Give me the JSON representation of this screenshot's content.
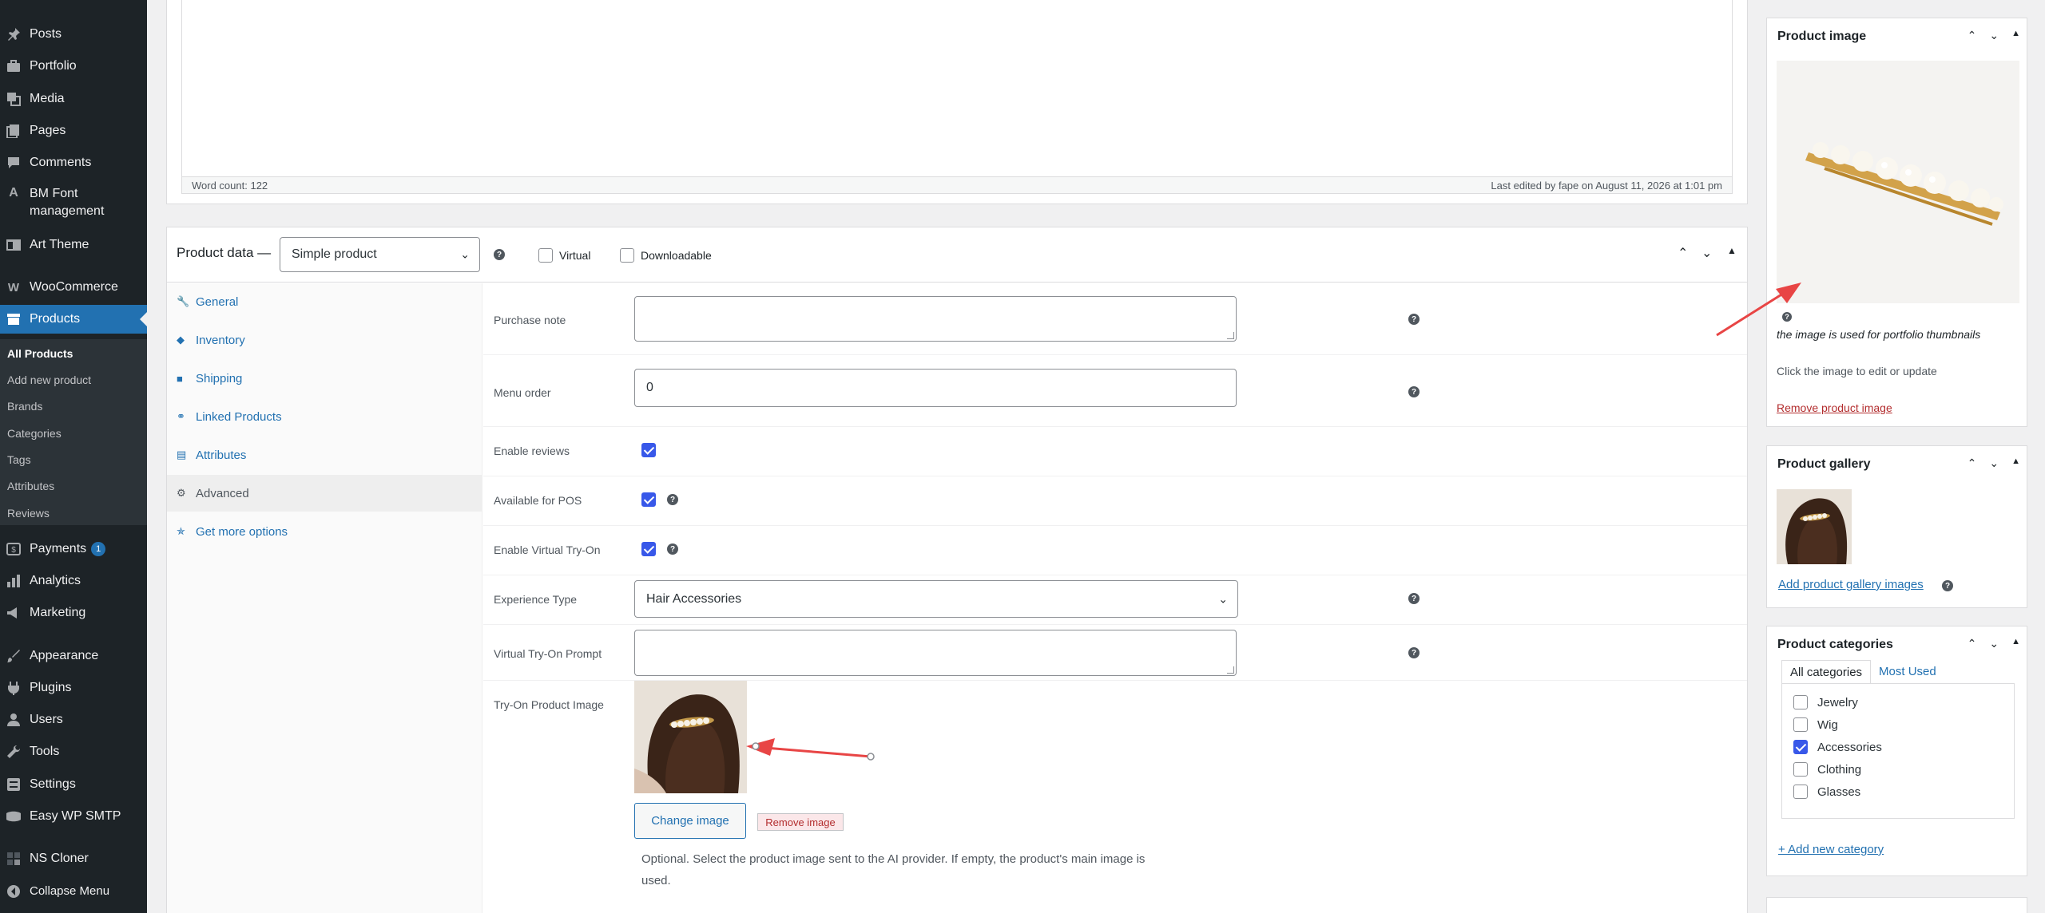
{
  "sidebar": {
    "items": [
      {
        "label": "Posts",
        "icon": "pushpin-icon"
      },
      {
        "label": "Portfolio",
        "icon": "portfolio-icon"
      },
      {
        "label": "Media",
        "icon": "media-icon"
      },
      {
        "label": "Pages",
        "icon": "pages-icon"
      },
      {
        "label": "Comments",
        "icon": "comments-icon"
      },
      {
        "label": "BM Font",
        "label2": "management",
        "icon": "font-icon"
      },
      {
        "label": "Art Theme",
        "icon": "theme-icon"
      },
      {
        "label": "WooCommerce",
        "icon": "woocommerce-icon"
      },
      {
        "label": "Products",
        "icon": "products-icon"
      },
      {
        "label": "Payments",
        "icon": "payments-icon",
        "badge": "1"
      },
      {
        "label": "Analytics",
        "icon": "analytics-icon"
      },
      {
        "label": "Marketing",
        "icon": "megaphone-icon"
      },
      {
        "label": "Appearance",
        "icon": "paintbrush-icon"
      },
      {
        "label": "Plugins",
        "icon": "plugins-icon"
      },
      {
        "label": "Users",
        "icon": "users-icon"
      },
      {
        "label": "Tools",
        "icon": "tools-icon"
      },
      {
        "label": "Settings",
        "icon": "settings-icon"
      },
      {
        "label": "Easy WP SMTP",
        "icon": "smtp-icon"
      },
      {
        "label": "NS Cloner",
        "icon": "cloner-icon"
      },
      {
        "label": "Collapse Menu",
        "icon": "collapse-icon"
      }
    ],
    "submenu": [
      "All Products",
      "Add new product",
      "Brands",
      "Categories",
      "Tags",
      "Attributes",
      "Reviews"
    ]
  },
  "editor": {
    "word_count": "Word count: 122",
    "last_edited": "Last edited by fape on August 11, 2026 at 1:01 pm"
  },
  "product_data": {
    "title": "Product data —",
    "type_select": "Simple product",
    "virtual_label": "Virtual",
    "downloadable_label": "Downloadable",
    "tabs": [
      "General",
      "Inventory",
      "Shipping",
      "Linked Products",
      "Attributes",
      "Advanced",
      "Get more options"
    ],
    "fields": {
      "purchase_note": {
        "label": "Purchase note",
        "value": ""
      },
      "menu_order": {
        "label": "Menu order",
        "value": "0"
      },
      "enable_reviews": {
        "label": "Enable reviews",
        "checked": true
      },
      "available_pos": {
        "label": "Available for POS",
        "checked": true
      },
      "enable_tryon": {
        "label": "Enable Virtual Try-On",
        "checked": true
      },
      "experience_type": {
        "label": "Experience Type",
        "value": "Hair Accessories"
      },
      "tryon_prompt": {
        "label": "Virtual Try-On Prompt",
        "value": ""
      },
      "tryon_image": {
        "label": "Try-On Product Image"
      }
    },
    "change_image": "Change image",
    "remove_image": "Remove image",
    "tryon_desc": "Optional. Select the product image sent to the AI provider. If empty, the product's main image is used."
  },
  "product_image": {
    "title": "Product image",
    "caption": "the image is used for portfolio thumbnails",
    "hint": "Click the image to edit or update",
    "remove_link": "Remove product image"
  },
  "product_gallery": {
    "title": "Product gallery",
    "add_link": "Add product gallery images"
  },
  "product_categories": {
    "title": "Product categories",
    "tab_all": "All categories",
    "tab_used": "Most Used",
    "items": [
      {
        "label": "Jewelry",
        "checked": false
      },
      {
        "label": "Wig",
        "checked": false
      },
      {
        "label": "Accessories",
        "checked": true
      },
      {
        "label": "Clothing",
        "checked": false
      },
      {
        "label": "Glasses",
        "checked": false
      }
    ],
    "add_link": "+ Add new category"
  },
  "colors": {
    "sidebar_bg": "#1d2327",
    "accent": "#2271b1",
    "checkbox": "#3858e9",
    "annotation_arrow": "#e84545"
  }
}
